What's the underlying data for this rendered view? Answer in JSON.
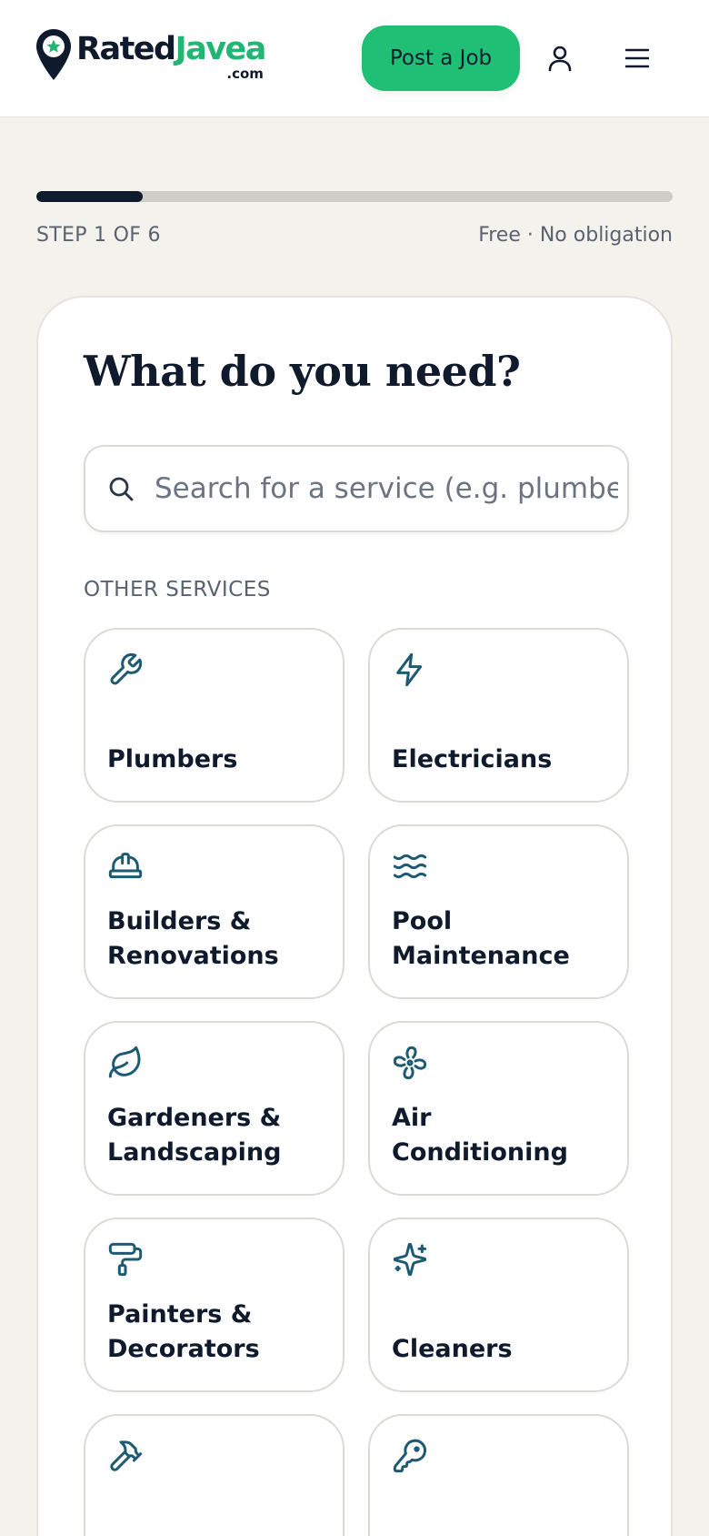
{
  "header": {
    "logo": {
      "word_rated": "Rated",
      "word_brand": "Javea",
      "suffix": ".com"
    },
    "post_job_label": "Post a Job",
    "user_icon": "user-icon",
    "menu_icon": "menu-icon"
  },
  "progress": {
    "fraction": 0.167,
    "step_label": "STEP 1 OF 6",
    "note": "Free · No obligation"
  },
  "card": {
    "title": "What do you need?",
    "search": {
      "placeholder": "Search for a service (e.g. plumber)",
      "value": ""
    },
    "section_label": "OTHER SERVICES",
    "services": [
      {
        "label": "Plumbers",
        "icon": "wrench-icon"
      },
      {
        "label": "Electricians",
        "icon": "lightning-icon"
      },
      {
        "label": "Builders & Renovations",
        "icon": "hard-hat-icon"
      },
      {
        "label": "Pool Maintenance",
        "icon": "waves-icon"
      },
      {
        "label": "Gardeners & Landscaping",
        "icon": "leaf-icon"
      },
      {
        "label": "Air Conditioning",
        "icon": "fan-icon"
      },
      {
        "label": "Painters & Decorators",
        "icon": "paint-roller-icon"
      },
      {
        "label": "Cleaners",
        "icon": "sparkles-icon"
      },
      {
        "label": "",
        "icon": "hammer-icon"
      },
      {
        "label": "",
        "icon": "key-icon"
      }
    ]
  },
  "colors": {
    "brand_green": "#1fbf76",
    "navy": "#0f1b2d",
    "icon_teal": "#1f5a73",
    "background": "#f4f2ed"
  }
}
